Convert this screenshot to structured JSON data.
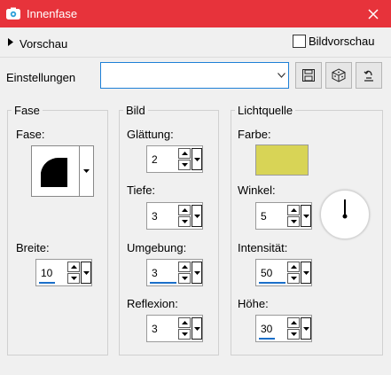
{
  "window": {
    "title": "Innenfase",
    "title_bg": "#e7333b"
  },
  "preview": {
    "label": "Vorschau",
    "checkbox_label": "Bildvorschau",
    "checked": false
  },
  "settings": {
    "label": "Einstellungen",
    "value": ""
  },
  "fase": {
    "title": "Fase",
    "fase_label": "Fase:",
    "breite_label": "Breite:",
    "breite_value": "10"
  },
  "bild": {
    "title": "Bild",
    "glaettung_label": "Glättung:",
    "glaettung_value": "2",
    "tiefe_label": "Tiefe:",
    "tiefe_value": "3",
    "umgebung_label": "Umgebung:",
    "umgebung_value": "3",
    "reflexion_label": "Reflexion:",
    "reflexion_value": "3"
  },
  "licht": {
    "title": "Lichtquelle",
    "farbe_label": "Farbe:",
    "farbe_color": "#d8d456",
    "winkel_label": "Winkel:",
    "winkel_value": "5",
    "intensitaet_label": "Intensität:",
    "intensitaet_value": "50",
    "hoehe_label": "Höhe:",
    "hoehe_value": "30"
  }
}
